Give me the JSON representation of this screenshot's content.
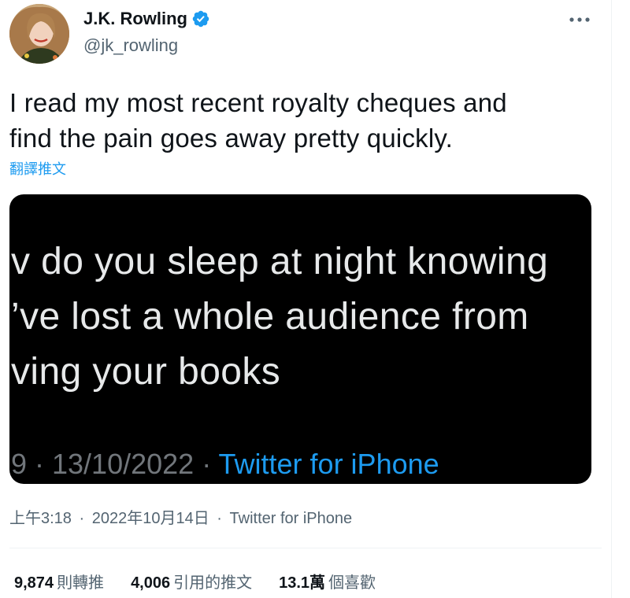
{
  "author": {
    "display_name": "J.K. Rowling",
    "handle": "@jk_rowling"
  },
  "icons": {
    "verified": "verified-badge-icon",
    "more": "more-options-icon"
  },
  "colors": {
    "accent": "#1d9bf0",
    "text": "#0f1419",
    "secondary": "#536471",
    "media_bg": "#000000",
    "media_text": "#e7e9ea"
  },
  "tweet": {
    "text_line_1": "I read my most recent royalty cheques and",
    "text_line_2": "find the pain goes away pretty quickly.",
    "translate_label": "翻譯推文"
  },
  "media": {
    "line_1": "v do you sleep at night knowing",
    "line_2": "’ve lost a whole audience from",
    "line_3": "ving your books",
    "meta_time": "9 · 13/10/2022 · ",
    "meta_source": "Twitter for iPhone"
  },
  "timestamp": {
    "time": "上午3:18",
    "separator": "·",
    "date": "2022年10月14日",
    "source": "Twitter for iPhone"
  },
  "stats": {
    "retweets_count": "9,874",
    "retweets_label": "則轉推",
    "quotes_count": "4,006",
    "quotes_label": "引用的推文",
    "likes_count": "13.1萬",
    "likes_label": "個喜歡"
  }
}
